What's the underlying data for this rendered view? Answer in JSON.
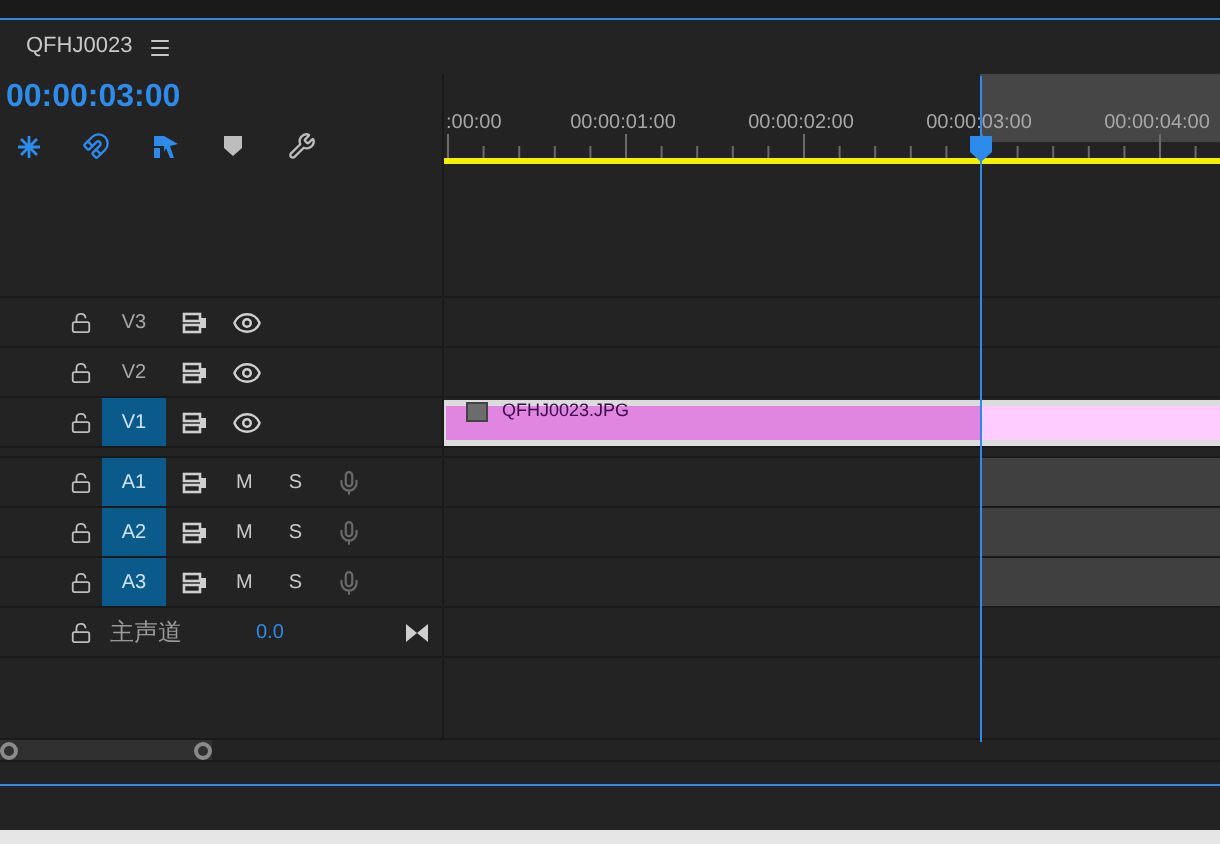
{
  "tab": {
    "title": "QFHJ0023"
  },
  "timecode": "00:00:03:00",
  "ruler": {
    "labels": [
      ":00:00",
      "00:00:01:00",
      "00:00:02:00",
      "00:00:03:00",
      "00:00:04:00"
    ]
  },
  "tracks": [
    {
      "kind": "video",
      "name": "V3",
      "selected": false
    },
    {
      "kind": "video",
      "name": "V2",
      "selected": false
    },
    {
      "kind": "video",
      "name": "V1",
      "selected": true
    },
    {
      "kind": "audio",
      "name": "A1",
      "selected": true,
      "mute": "M",
      "solo": "S"
    },
    {
      "kind": "audio",
      "name": "A2",
      "selected": true,
      "mute": "M",
      "solo": "S"
    },
    {
      "kind": "audio",
      "name": "A3",
      "selected": true,
      "mute": "M",
      "solo": "S"
    }
  ],
  "master": {
    "label": "主声道",
    "value": "0.0"
  },
  "clip": {
    "name": "QFHJ0023.JPG"
  }
}
